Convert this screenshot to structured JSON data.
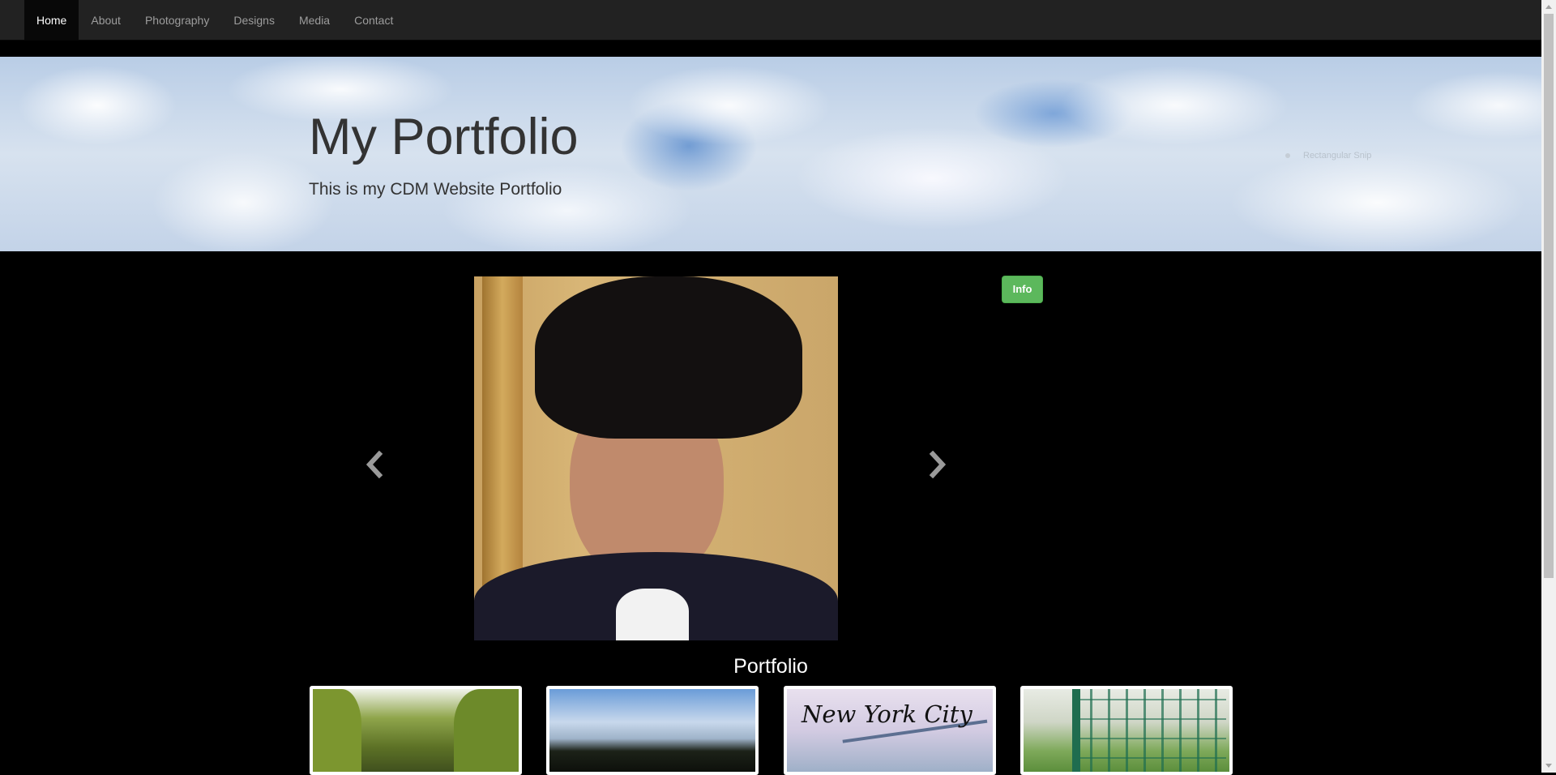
{
  "nav": {
    "items": [
      {
        "label": "Home",
        "active": true
      },
      {
        "label": "About"
      },
      {
        "label": "Photography"
      },
      {
        "label": "Designs"
      },
      {
        "label": "Media"
      },
      {
        "label": "Contact"
      }
    ]
  },
  "jumbotron": {
    "title": "My Portfolio",
    "subtitle": "This is my CDM Website Portfolio",
    "ghost_label": "Rectangular Snip"
  },
  "carousel": {
    "prev_icon": "chevron-left-icon",
    "next_icon": "chevron-right-icon"
  },
  "info_button": {
    "label": "Info",
    "color": "#5cb85c"
  },
  "portfolio": {
    "title": "Portfolio",
    "thumbnails": [
      {
        "overlay_text": ""
      },
      {
        "overlay_text": ""
      },
      {
        "overlay_text": "New York City"
      },
      {
        "overlay_text": ""
      }
    ]
  },
  "colors": {
    "navbar_bg": "#222222",
    "page_bg": "#000000",
    "nav_active_text": "#ffffff",
    "nav_text": "#9d9d9d"
  }
}
